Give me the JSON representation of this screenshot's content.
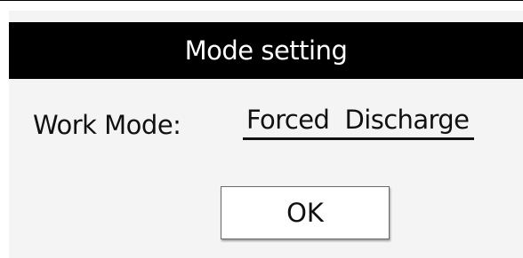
{
  "dialog": {
    "title": "Mode setting",
    "work_mode_label": "Work Mode:",
    "work_mode_value": "Forced  Discharge",
    "ok_label": "OK"
  },
  "colors": {
    "title_bar_bg": "#000000",
    "title_text": "#ffffff",
    "dialog_bg": "#f4f4f4",
    "button_bg": "#ffffff"
  }
}
